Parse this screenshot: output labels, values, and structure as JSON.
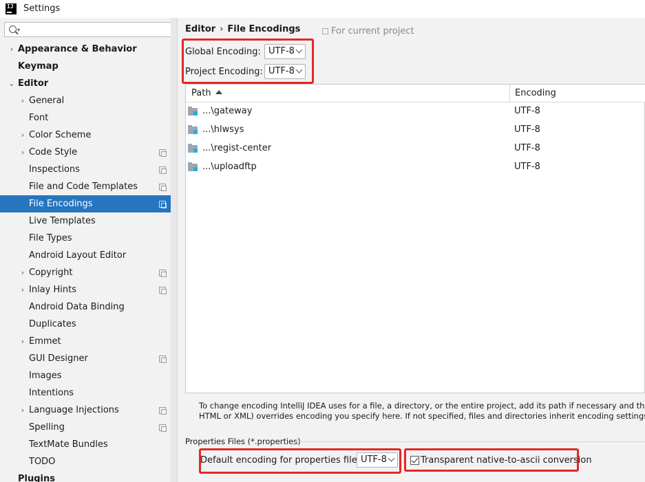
{
  "window": {
    "title": "Settings"
  },
  "sidebar": {
    "search_placeholder": "",
    "items": [
      {
        "label": "Appearance & Behavior",
        "level": 0,
        "bold": true,
        "arrow": "›",
        "icon": false
      },
      {
        "label": "Keymap",
        "level": 0,
        "bold": true,
        "arrow": "",
        "icon": false
      },
      {
        "label": "Editor",
        "level": 0,
        "bold": true,
        "arrow": "⌄",
        "icon": false
      },
      {
        "label": "General",
        "level": 1,
        "bold": false,
        "arrow": "›",
        "icon": false
      },
      {
        "label": "Font",
        "level": 1,
        "bold": false,
        "arrow": "",
        "icon": false
      },
      {
        "label": "Color Scheme",
        "level": 1,
        "bold": false,
        "arrow": "›",
        "icon": false
      },
      {
        "label": "Code Style",
        "level": 1,
        "bold": false,
        "arrow": "›",
        "icon": true
      },
      {
        "label": "Inspections",
        "level": 1,
        "bold": false,
        "arrow": "",
        "icon": true
      },
      {
        "label": "File and Code Templates",
        "level": 1,
        "bold": false,
        "arrow": "",
        "icon": true
      },
      {
        "label": "File Encodings",
        "level": 1,
        "bold": false,
        "arrow": "",
        "icon": true,
        "selected": true
      },
      {
        "label": "Live Templates",
        "level": 1,
        "bold": false,
        "arrow": "",
        "icon": false
      },
      {
        "label": "File Types",
        "level": 1,
        "bold": false,
        "arrow": "",
        "icon": false
      },
      {
        "label": "Android Layout Editor",
        "level": 1,
        "bold": false,
        "arrow": "",
        "icon": false
      },
      {
        "label": "Copyright",
        "level": 1,
        "bold": false,
        "arrow": "›",
        "icon": true
      },
      {
        "label": "Inlay Hints",
        "level": 1,
        "bold": false,
        "arrow": "›",
        "icon": true
      },
      {
        "label": "Android Data Binding",
        "level": 1,
        "bold": false,
        "arrow": "",
        "icon": false
      },
      {
        "label": "Duplicates",
        "level": 1,
        "bold": false,
        "arrow": "",
        "icon": false
      },
      {
        "label": "Emmet",
        "level": 1,
        "bold": false,
        "arrow": "›",
        "icon": false
      },
      {
        "label": "GUI Designer",
        "level": 1,
        "bold": false,
        "arrow": "",
        "icon": true
      },
      {
        "label": "Images",
        "level": 1,
        "bold": false,
        "arrow": "",
        "icon": false
      },
      {
        "label": "Intentions",
        "level": 1,
        "bold": false,
        "arrow": "",
        "icon": false
      },
      {
        "label": "Language Injections",
        "level": 1,
        "bold": false,
        "arrow": "›",
        "icon": true
      },
      {
        "label": "Spelling",
        "level": 1,
        "bold": false,
        "arrow": "",
        "icon": true
      },
      {
        "label": "TextMate Bundles",
        "level": 1,
        "bold": false,
        "arrow": "",
        "icon": false
      },
      {
        "label": "TODO",
        "level": 1,
        "bold": false,
        "arrow": "",
        "icon": false
      },
      {
        "label": "Plugins",
        "level": 0,
        "bold": true,
        "arrow": "",
        "icon": false
      }
    ]
  },
  "main": {
    "breadcrumb": {
      "parent": "Editor",
      "separator": "›",
      "current": "File Encodings"
    },
    "scope_note": "For current project",
    "global_encoding": {
      "label": "Global Encoding:",
      "value": "UTF-8"
    },
    "project_encoding": {
      "label": "Project Encoding:",
      "value": "UTF-8"
    },
    "table": {
      "columns": [
        "Path",
        "Encoding"
      ],
      "rows": [
        {
          "path": "...\\gateway",
          "encoding": "UTF-8"
        },
        {
          "path": "...\\hlwsys",
          "encoding": "UTF-8"
        },
        {
          "path": "...\\regist-center",
          "encoding": "UTF-8"
        },
        {
          "path": "...\\uploadftp",
          "encoding": "UTF-8"
        }
      ]
    },
    "help_text_line1": "To change encoding IntelliJ IDEA uses for a file, a directory, or the entire project, add its path if necessary and then select en",
    "help_text_line2": "HTML or XML) overrides encoding you specify here. If not specified, files and directories inherit encoding settings from the",
    "properties": {
      "title": "Properties Files (*.properties)",
      "default_label": "Default encoding for properties files:",
      "default_value": "UTF-8",
      "transparent_label": "Transparent native-to-ascii conversion",
      "transparent_checked": true
    }
  },
  "colors": {
    "selection": "#2675bf",
    "highlight_box": "#e12828",
    "folder": "#9aa7b4"
  }
}
